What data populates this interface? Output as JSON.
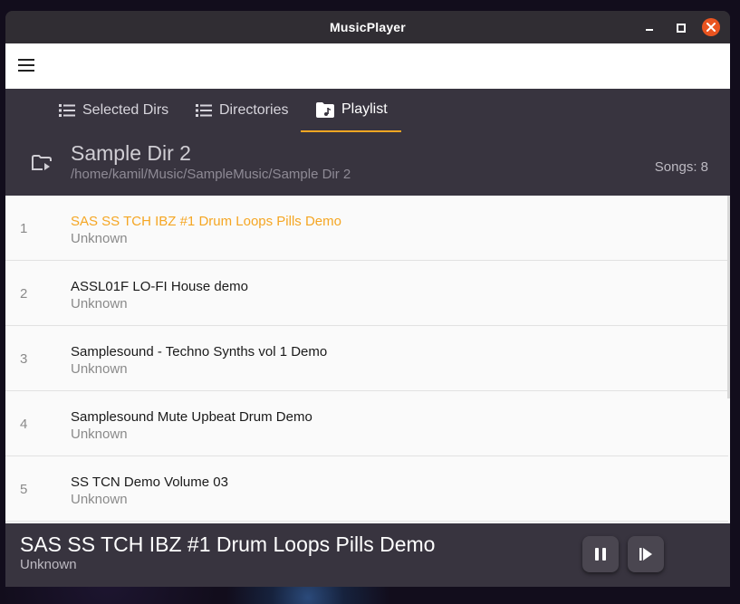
{
  "window": {
    "title": "MusicPlayer"
  },
  "tabs": [
    {
      "label": "Selected Dirs",
      "icon": "list-icon"
    },
    {
      "label": "Directories",
      "icon": "list-icon"
    },
    {
      "label": "Playlist",
      "icon": "music-folder-icon",
      "active": true
    }
  ],
  "directory": {
    "name": "Sample Dir 2",
    "path": "/home/kamil/Music/SampleMusic/Sample Dir 2",
    "songs_label": "Songs: 8"
  },
  "songs": [
    {
      "num": "1",
      "title": "SAS SS TCH IBZ #1 Drum Loops Pills Demo",
      "artist": "Unknown",
      "playing": true
    },
    {
      "num": "2",
      "title": "ASSL01F LO-FI House demo",
      "artist": "Unknown"
    },
    {
      "num": "3",
      "title": "Samplesound - Techno Synths vol 1 Demo",
      "artist": "Unknown"
    },
    {
      "num": "4",
      "title": "Samplesound Mute Upbeat Drum Demo",
      "artist": "Unknown"
    },
    {
      "num": "5",
      "title": "SS TCN Demo Volume 03",
      "artist": "Unknown"
    }
  ],
  "now_playing": {
    "title": "SAS SS TCH IBZ #1 Drum Loops Pills Demo",
    "artist": "Unknown"
  },
  "colors": {
    "accent": "#f5a623",
    "header_bg": "#38343f",
    "close_button": "#e95420"
  }
}
